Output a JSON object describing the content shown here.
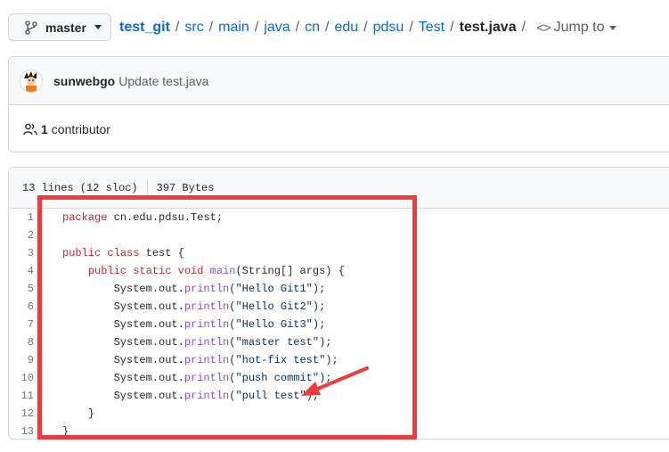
{
  "branch": {
    "label": "master",
    "icon": "git-branch-icon"
  },
  "breadcrumb": {
    "root": "test_git",
    "segments": [
      "src",
      "main",
      "java",
      "cn",
      "edu",
      "pdsu",
      "Test"
    ],
    "file": "test.java",
    "jump_label": "Jump to",
    "jump_icon": "code-icon"
  },
  "commit": {
    "author": "sunwebgo",
    "message": "Update test.java"
  },
  "contributors": {
    "count": "1",
    "label": "contributor"
  },
  "file": {
    "lines_info": "13 lines (12 sloc)",
    "size": "397 Bytes",
    "code": [
      {
        "num": "1",
        "parts": [
          {
            "t": "package",
            "c": "kw"
          },
          {
            "t": " cn.edu.pdsu.Test;"
          }
        ]
      },
      {
        "num": "2",
        "parts": []
      },
      {
        "num": "3",
        "parts": [
          {
            "t": "public",
            "c": "kw"
          },
          {
            "t": " "
          },
          {
            "t": "class",
            "c": "kw"
          },
          {
            "t": " test {"
          }
        ]
      },
      {
        "num": "4",
        "parts": [
          {
            "t": "    "
          },
          {
            "t": "public",
            "c": "kw"
          },
          {
            "t": " "
          },
          {
            "t": "static",
            "c": "kw"
          },
          {
            "t": " "
          },
          {
            "t": "void",
            "c": "kw"
          },
          {
            "t": " "
          },
          {
            "t": "main",
            "c": "fn"
          },
          {
            "t": "(String[] args) {"
          }
        ]
      },
      {
        "num": "5",
        "parts": [
          {
            "t": "        System.out."
          },
          {
            "t": "println",
            "c": "fn"
          },
          {
            "t": "("
          },
          {
            "t": "\"Hello Git1\"",
            "c": "str"
          },
          {
            "t": ");"
          }
        ]
      },
      {
        "num": "6",
        "parts": [
          {
            "t": "        System.out."
          },
          {
            "t": "println",
            "c": "fn"
          },
          {
            "t": "("
          },
          {
            "t": "\"Hello Git2\"",
            "c": "str"
          },
          {
            "t": ");"
          }
        ]
      },
      {
        "num": "7",
        "parts": [
          {
            "t": "        System.out."
          },
          {
            "t": "println",
            "c": "fn"
          },
          {
            "t": "("
          },
          {
            "t": "\"Hello Git3\"",
            "c": "str"
          },
          {
            "t": ");"
          }
        ]
      },
      {
        "num": "8",
        "parts": [
          {
            "t": "        System.out."
          },
          {
            "t": "println",
            "c": "fn"
          },
          {
            "t": "("
          },
          {
            "t": "\"master test\"",
            "c": "str"
          },
          {
            "t": ");"
          }
        ]
      },
      {
        "num": "9",
        "parts": [
          {
            "t": "        System.out."
          },
          {
            "t": "println",
            "c": "fn"
          },
          {
            "t": "("
          },
          {
            "t": "\"hot-fix test\"",
            "c": "str"
          },
          {
            "t": ");"
          }
        ]
      },
      {
        "num": "10",
        "parts": [
          {
            "t": "        System.out."
          },
          {
            "t": "println",
            "c": "fn"
          },
          {
            "t": "("
          },
          {
            "t": "\"push commit\"",
            "c": "str"
          },
          {
            "t": ");"
          }
        ]
      },
      {
        "num": "11",
        "parts": [
          {
            "t": "        System.out."
          },
          {
            "t": "println",
            "c": "fn"
          },
          {
            "t": "("
          },
          {
            "t": "\"pull test\"",
            "c": "str"
          },
          {
            "t": ");"
          }
        ]
      },
      {
        "num": "12",
        "parts": [
          {
            "t": "    }"
          }
        ]
      },
      {
        "num": "13",
        "parts": [
          {
            "t": "}"
          }
        ]
      }
    ]
  },
  "annotation": {
    "color": "#ef3b3b"
  }
}
